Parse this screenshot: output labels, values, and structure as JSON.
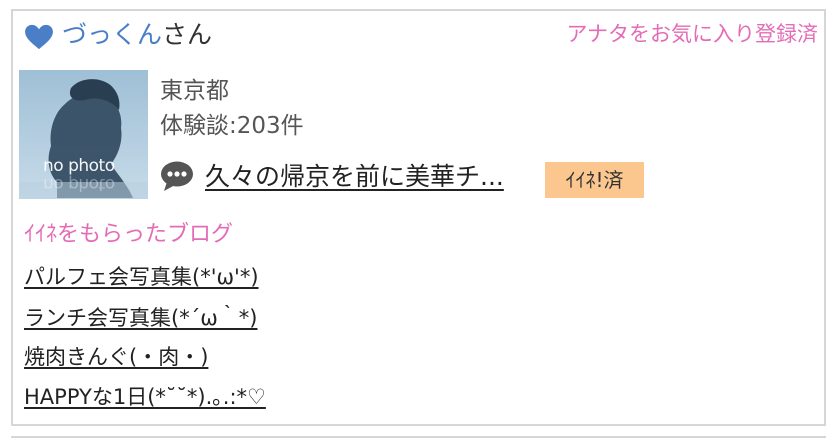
{
  "user": {
    "name": "づっくん",
    "name_suffix": "さん",
    "favorite_status": "アナタをお気に入り登録済",
    "location": "東京都",
    "reviews": "体験談:203件",
    "avatar_placeholder": "no photo"
  },
  "post": {
    "title": "久々の帰京を前に美華チ...",
    "like_badge": "ｲｲﾈ!済"
  },
  "liked_blogs": {
    "heading": "ｲｲﾈをもらったブログ",
    "items": [
      {
        "title": "パルフェ会写真集(*'ω'*) "
      },
      {
        "title": "ランチ会写真集(*´ω｀*)"
      },
      {
        "title": "焼肉きんぐ(・肉・)"
      },
      {
        "title": "HAPPYな1日(*˘˘*).｡.:*♡"
      }
    ]
  },
  "colors": {
    "accent_pink": "#e46cb7",
    "name_blue": "#4a7fc8",
    "badge_orange": "#fbc78f",
    "border_gray": "#d6d6d6"
  },
  "icons": {
    "heart": "heart-icon",
    "comment": "speech-bubble-icon"
  }
}
